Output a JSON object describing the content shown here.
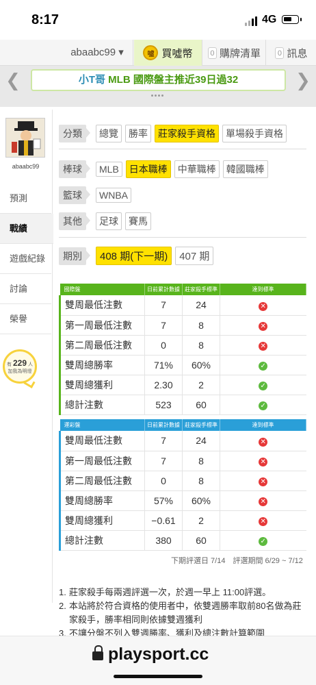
{
  "status": {
    "time": "8:17",
    "network": "4G"
  },
  "nav": {
    "username": "abaabc99 ▾",
    "coin_label": "買噓幣",
    "coin_icon_text": "噓",
    "cart_count": "0",
    "cart_label": "購牌清單",
    "msg_count": "0",
    "msg_label": "訊息"
  },
  "banner": {
    "prefix": "小T哥",
    "text": "MLB 國際盤主推近39日過32"
  },
  "sidebar": {
    "username": "abaabc99",
    "items": [
      {
        "label": "預測",
        "active": false
      },
      {
        "label": "戰績",
        "active": true
      },
      {
        "label": "遊戲紀錄",
        "active": false
      },
      {
        "label": "討論",
        "active": false
      },
      {
        "label": "榮譽",
        "active": false
      }
    ],
    "likes_prefix": "有",
    "likes_count": "229",
    "likes_suffix": "人",
    "likes_text": "加我為明燈"
  },
  "filters": {
    "category": {
      "label": "分類",
      "options": [
        "總覽",
        "勝率",
        "莊家殺手資格",
        "單場殺手資格"
      ],
      "selected": 2
    },
    "baseball": {
      "label": "棒球",
      "options": [
        "MLB",
        "日本職棒",
        "中華職棒",
        "韓國職棒"
      ],
      "selected": 1
    },
    "basketball": {
      "label": "籃球",
      "options": [
        "WNBA"
      ],
      "selected": -1
    },
    "other": {
      "label": "其他",
      "options": [
        "足球",
        "賽馬"
      ],
      "selected": -1
    }
  },
  "period": {
    "label": "期別",
    "options": [
      "408 期(下一期)",
      "407 期"
    ],
    "selected": 0
  },
  "tables": [
    {
      "title": "國際盤",
      "color": "#58b41c",
      "headers": [
        "日前累計數據",
        "莊家殺手標準",
        "達到標準"
      ],
      "rows": [
        {
          "label": "雙周最低注數",
          "current": "7",
          "standard": "24",
          "met": false
        },
        {
          "label": "第一周最低注數",
          "current": "7",
          "standard": "8",
          "met": false
        },
        {
          "label": "第二周最低注數",
          "current": "0",
          "standard": "8",
          "met": false
        },
        {
          "label": "雙周總勝率",
          "current": "71%",
          "standard": "60%",
          "met": true
        },
        {
          "label": "雙周總獲利",
          "current": "2.30",
          "standard": "2",
          "met": true
        },
        {
          "label": "總計注數",
          "current": "523",
          "standard": "60",
          "met": true
        }
      ]
    },
    {
      "title": "運彩盤",
      "color": "#2a9fd8",
      "headers": [
        "日前累計數據",
        "莊家殺手標準",
        "達到標準"
      ],
      "rows": [
        {
          "label": "雙周最低注數",
          "current": "7",
          "standard": "24",
          "met": false
        },
        {
          "label": "第一周最低注數",
          "current": "7",
          "standard": "8",
          "met": false
        },
        {
          "label": "第二周最低注數",
          "current": "0",
          "standard": "8",
          "met": false
        },
        {
          "label": "雙周總勝率",
          "current": "57%",
          "standard": "60%",
          "met": false
        },
        {
          "label": "雙周總獲利",
          "current": "−0.61",
          "standard": "2",
          "met": false
        },
        {
          "label": "總計注數",
          "current": "380",
          "standard": "60",
          "met": true
        }
      ]
    }
  ],
  "eval_note": "下期評選日 7/14　評選期間 6/29 ~ 7/12",
  "rules": [
    "莊家殺手每兩週評選一次，於週一早上 11:00評選。",
    "本站將於符合資格的使用者中，依雙週勝率取前80名做為莊家殺手，勝率相同則依據雙週獲利",
    "不讓分盤不列入雙週勝率、獲利及總注數計算範圍"
  ],
  "address": {
    "url": "playsport.cc"
  }
}
